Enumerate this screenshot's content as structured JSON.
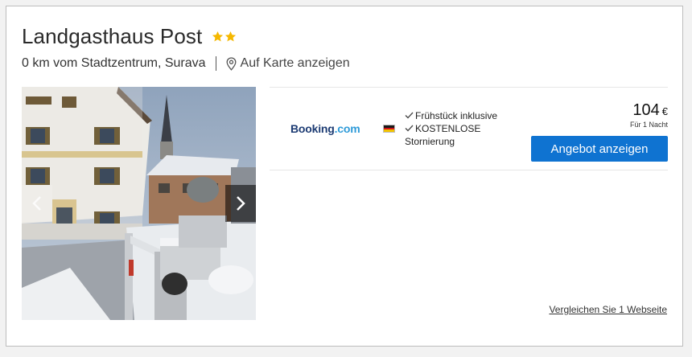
{
  "hotel": {
    "name": "Landgasthaus Post",
    "star_rating": 2,
    "star_color": "#f5b800",
    "distance": "0 km vom Stadtzentrum, Surava",
    "map_label": "Auf Karte anzeigen"
  },
  "deal": {
    "provider_part1": "Booking",
    "provider_part2": ".com",
    "feature1": "Frühstück inklusive",
    "feature2": "KOSTENLOSE",
    "feature2b": "Stornierung",
    "price": "104",
    "currency": "€",
    "per_night": "Für 1 Nacht",
    "button_label": "Angebot anzeigen",
    "button_color": "#0f73d1"
  },
  "compare_label": "Vergleichen Sie 1 Webseite"
}
